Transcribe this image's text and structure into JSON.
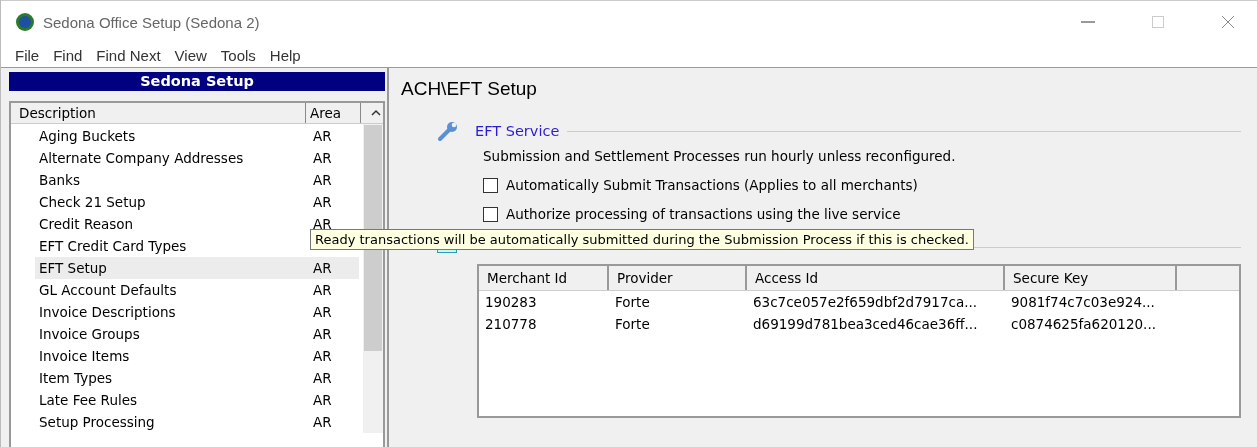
{
  "window": {
    "title": "Sedona Office Setup (Sedona 2)"
  },
  "menu": [
    "File",
    "Find",
    "Find Next",
    "View",
    "Tools",
    "Help"
  ],
  "sidebar": {
    "title": "Sedona Setup",
    "columns": [
      "Description",
      "Area"
    ],
    "items": [
      {
        "label": "Aging Buckets",
        "area": "AR",
        "selected": false
      },
      {
        "label": "Alternate Company Addresses",
        "area": "AR",
        "selected": false
      },
      {
        "label": "Banks",
        "area": "AR",
        "selected": false
      },
      {
        "label": "Check 21 Setup",
        "area": "AR",
        "selected": false
      },
      {
        "label": "Credit Reason",
        "area": "AR",
        "selected": false
      },
      {
        "label": "EFT Credit Card Types",
        "selected": false
      },
      {
        "label": "EFT Setup",
        "area": "AR",
        "selected": true
      },
      {
        "label": "GL Account Defaults",
        "area": "AR",
        "selected": false
      },
      {
        "label": "Invoice Descriptions",
        "area": "AR",
        "selected": false
      },
      {
        "label": "Invoice Groups",
        "area": "AR",
        "selected": false
      },
      {
        "label": "Invoice Items",
        "area": "AR",
        "selected": false
      },
      {
        "label": "Item Types",
        "area": "AR",
        "selected": false
      },
      {
        "label": "Late Fee Rules",
        "area": "AR",
        "selected": false
      },
      {
        "label": "Setup Processing",
        "area": "AR",
        "selected": false
      }
    ]
  },
  "content": {
    "title": "ACH\\EFT Setup",
    "section": {
      "title": "EFT Service",
      "note": "Submission and Settlement Processes run hourly unless reconfigured.",
      "options": [
        {
          "label": "Automatically Submit Transactions (Applies to all merchants)",
          "checked": false
        },
        {
          "label": "Authorize processing of transactions using the live service",
          "checked": false
        }
      ]
    },
    "table": {
      "columns": [
        "Merchant Id",
        "Provider",
        "Access Id",
        "Secure Key"
      ],
      "rows": [
        [
          "190283",
          "Forte",
          "63c7ce057e2f659dbf2d7917ca...",
          "9081f74c7c03e924..."
        ],
        [
          "210778",
          "Forte",
          "d69199d781bea3ced46cae36ff...",
          "c0874625fa620120..."
        ]
      ]
    }
  },
  "tooltip": "Ready transactions will be automatically submitted during the Submission Process if this is checked."
}
